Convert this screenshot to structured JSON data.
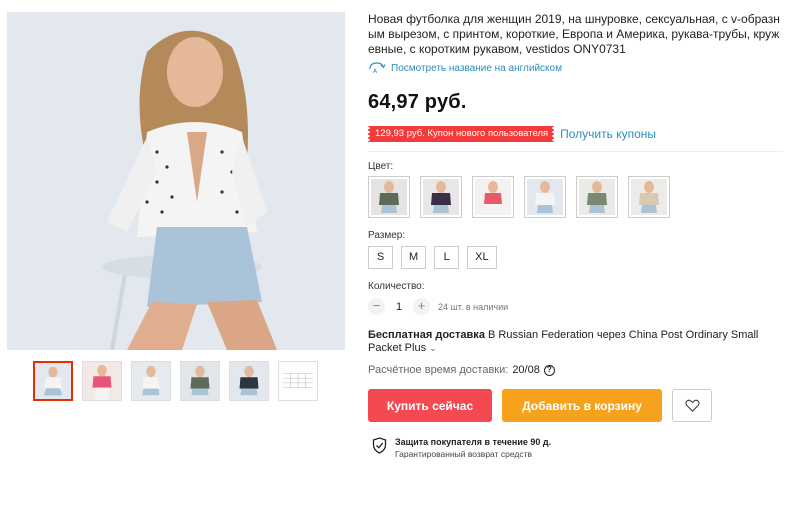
{
  "product": {
    "title": "Новая футболка для женщин 2019, на шнуровке, сексуальная, с v-образным вырезом, с принтом, короткие, Европа и Америка, рукава-трубы, кружевные, с коротким рукавом, vestidos ONY0731",
    "translate_link": "Посмотреть название на английском",
    "price": "64,97 руб.",
    "coupon": "129,93 руб. Купон нового пользователя",
    "get_coupons": "Получить купоны"
  },
  "options": {
    "color_label": "Цвет:",
    "size_label": "Размер:",
    "sizes": [
      "S",
      "M",
      "L",
      "XL"
    ],
    "quantity_label": "Количество:",
    "quantity_minus": "−",
    "quantity_value": "1",
    "quantity_plus": "+",
    "stock": "24 шт. в наличии"
  },
  "shipping": {
    "free_label": "Бесплатная доставка",
    "text": "В Russian Federation через China Post Ordinary Small Packet Plus",
    "more": "⌄",
    "estimate_label": "Расчётное время доставки:",
    "estimate_date": "20/08",
    "help": "?"
  },
  "actions": {
    "buy_now": "Купить сейчас",
    "add_to_cart": "Добавить в корзину"
  },
  "protection": {
    "title": "Защита покупателя в течение 90 д.",
    "subtitle": "Гарантированный возврат средств"
  },
  "colors": {
    "accent_red": "#f34950",
    "accent_orange": "#f7a21c",
    "link_blue": "#2a8fbd",
    "coupon_red": "#f33b3b"
  }
}
